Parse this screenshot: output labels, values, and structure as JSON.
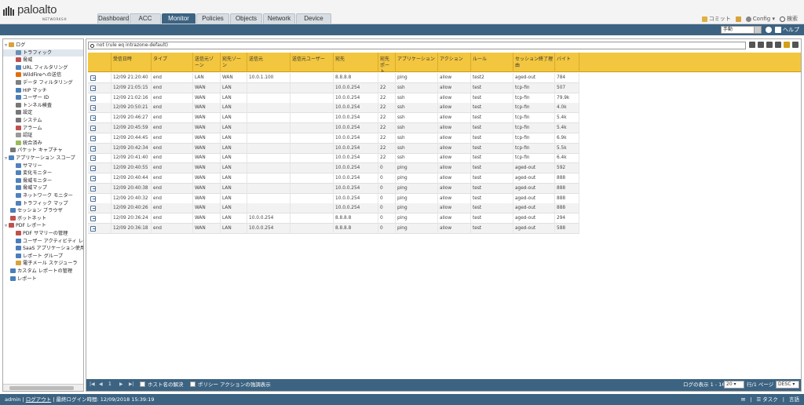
{
  "header": {
    "logo_text": "paloalto",
    "logo_sub": "NETWORKS®",
    "tabs": [
      {
        "label": "Dashboard",
        "active": false
      },
      {
        "label": "ACC",
        "active": false
      },
      {
        "label": "Monitor",
        "active": true
      },
      {
        "label": "Policies",
        "active": false
      },
      {
        "label": "Objects",
        "active": false
      },
      {
        "label": "Network",
        "active": false
      },
      {
        "label": "Device",
        "active": false
      }
    ],
    "commit": "コミット",
    "config": "Config",
    "search": "検索"
  },
  "toolbar": {
    "refresh_value": "手動",
    "help": "ヘルプ"
  },
  "sidebar": {
    "items": [
      {
        "label": "ログ",
        "indent": 0,
        "icon": "folder-icon",
        "color": "#d9a23a"
      },
      {
        "label": "トラフィック",
        "indent": 2,
        "icon": "traffic-log-icon",
        "color": "#6a8fb8",
        "selected": true
      },
      {
        "label": "脅威",
        "indent": 2,
        "icon": "threat-log-icon",
        "color": "#c0504d"
      },
      {
        "label": "URL フィルタリング",
        "indent": 2,
        "icon": "url-log-icon",
        "color": "#4f81bd"
      },
      {
        "label": "WildFireへの送信",
        "indent": 2,
        "icon": "wildfire-icon",
        "color": "#e46c0a"
      },
      {
        "label": "データ フィルタリング",
        "indent": 2,
        "icon": "data-filter-icon",
        "color": "#7f7f7f"
      },
      {
        "label": "HIP マッチ",
        "indent": 2,
        "icon": "hip-icon",
        "color": "#4a7ebb"
      },
      {
        "label": "ユーザー ID",
        "indent": 2,
        "icon": "user-id-icon",
        "color": "#4a7ebb"
      },
      {
        "label": "トンネル検査",
        "indent": 2,
        "icon": "tunnel-icon",
        "color": "#777777"
      },
      {
        "label": "設定",
        "indent": 2,
        "icon": "config-log-icon",
        "color": "#777777"
      },
      {
        "label": "システム",
        "indent": 2,
        "icon": "system-log-icon",
        "color": "#777777"
      },
      {
        "label": "アラーム",
        "indent": 2,
        "icon": "alarm-icon",
        "color": "#c0504d"
      },
      {
        "label": "認証",
        "indent": 2,
        "icon": "auth-icon",
        "color": "#999999"
      },
      {
        "label": "統合済み",
        "indent": 2,
        "icon": "unified-icon",
        "color": "#9bbb59"
      },
      {
        "label": "パケット キャプチャ",
        "indent": 1,
        "icon": "packet-capture-icon",
        "color": "#777777"
      },
      {
        "label": "アプリケーション スコープ",
        "indent": 0,
        "icon": "app-scope-icon",
        "color": "#4f81bd"
      },
      {
        "label": "サマリー",
        "indent": 2,
        "icon": "summary-icon",
        "color": "#4f81bd"
      },
      {
        "label": "変化モニター",
        "indent": 2,
        "icon": "change-monitor-icon",
        "color": "#4f81bd"
      },
      {
        "label": "脅威モニター",
        "indent": 2,
        "icon": "threat-monitor-icon",
        "color": "#4f81bd"
      },
      {
        "label": "脅威マップ",
        "indent": 2,
        "icon": "threat-map-icon",
        "color": "#4f81bd"
      },
      {
        "label": "ネットワーク モニター",
        "indent": 2,
        "icon": "network-monitor-icon",
        "color": "#4f81bd"
      },
      {
        "label": "トラフィック マップ",
        "indent": 2,
        "icon": "traffic-map-icon",
        "color": "#4f81bd"
      },
      {
        "label": "セッション ブラウザ",
        "indent": 1,
        "icon": "session-browser-icon",
        "color": "#4a7ebb"
      },
      {
        "label": "ボットネット",
        "indent": 1,
        "icon": "botnet-icon",
        "color": "#c0504d"
      },
      {
        "label": "PDF レポート",
        "indent": 0,
        "icon": "pdf-folder-icon",
        "color": "#c0504d"
      },
      {
        "label": "PDF サマリーの管理",
        "indent": 2,
        "icon": "pdf-icon",
        "color": "#c0504d"
      },
      {
        "label": "ユーザー アクティビティ レポート",
        "indent": 2,
        "icon": "user-activity-icon",
        "color": "#4a7ebb"
      },
      {
        "label": "SaaS アプリケーション使用率",
        "indent": 2,
        "icon": "saas-icon",
        "color": "#4a7ebb"
      },
      {
        "label": "レポート グループ",
        "indent": 2,
        "icon": "report-group-icon",
        "color": "#4a7ebb"
      },
      {
        "label": "電子メール スケジューラ",
        "indent": 2,
        "icon": "email-icon",
        "color": "#d9a23a"
      },
      {
        "label": "カスタム レポートの管理",
        "indent": 1,
        "icon": "custom-report-icon",
        "color": "#4a7ebb"
      },
      {
        "label": "レポート",
        "indent": 1,
        "icon": "report-icon",
        "color": "#4a7ebb"
      }
    ]
  },
  "filter": {
    "query": "not (rule eq intrazone-default)"
  },
  "table": {
    "columns": [
      "受信日時",
      "タイプ",
      "送信元ゾーン",
      "宛先ゾーン",
      "送信元",
      "送信元ユーザー",
      "宛先",
      "宛先ポート",
      "アプリケーション",
      "アクション",
      "ルール",
      "セッション終了理由",
      "バイト"
    ],
    "rows": [
      [
        "12/09 21:20:40",
        "end",
        "LAN",
        "WAN",
        "10.0.1.100",
        "",
        "8.8.8.8",
        "",
        "ping",
        "allow",
        "test2",
        "aged-out",
        "784"
      ],
      [
        "12/09 21:05:15",
        "end",
        "WAN",
        "LAN",
        "",
        "",
        "10.0.0.254",
        "22",
        "ssh",
        "allow",
        "test",
        "tcp-fin",
        "507"
      ],
      [
        "12/09 21:02:16",
        "end",
        "WAN",
        "LAN",
        "",
        "",
        "10.0.0.254",
        "22",
        "ssh",
        "allow",
        "test",
        "tcp-fin",
        "79.9k"
      ],
      [
        "12/09 20:50:21",
        "end",
        "WAN",
        "LAN",
        "",
        "",
        "10.0.0.254",
        "22",
        "ssh",
        "allow",
        "test",
        "tcp-fin",
        "4.0k"
      ],
      [
        "12/09 20:46:27",
        "end",
        "WAN",
        "LAN",
        "",
        "",
        "10.0.0.254",
        "22",
        "ssh",
        "allow",
        "test",
        "tcp-fin",
        "5.4k"
      ],
      [
        "12/09 20:45:59",
        "end",
        "WAN",
        "LAN",
        "",
        "",
        "10.0.0.254",
        "22",
        "ssh",
        "allow",
        "test",
        "tcp-fin",
        "5.4k"
      ],
      [
        "12/09 20:44:45",
        "end",
        "WAN",
        "LAN",
        "",
        "",
        "10.0.0.254",
        "22",
        "ssh",
        "allow",
        "test",
        "tcp-fin",
        "6.9k"
      ],
      [
        "12/09 20:42:34",
        "end",
        "WAN",
        "LAN",
        "",
        "",
        "10.0.0.254",
        "22",
        "ssh",
        "allow",
        "test",
        "tcp-fin",
        "5.5k"
      ],
      [
        "12/09 20:41:40",
        "end",
        "WAN",
        "LAN",
        "",
        "",
        "10.0.0.254",
        "22",
        "ssh",
        "allow",
        "test",
        "tcp-fin",
        "6.4k"
      ],
      [
        "12/09 20:40:55",
        "end",
        "WAN",
        "LAN",
        "",
        "",
        "10.0.0.254",
        "0",
        "ping",
        "allow",
        "test",
        "aged-out",
        "592"
      ],
      [
        "12/09 20:40:44",
        "end",
        "WAN",
        "LAN",
        "",
        "",
        "10.0.0.254",
        "0",
        "ping",
        "allow",
        "test",
        "aged-out",
        "888"
      ],
      [
        "12/09 20:40:38",
        "end",
        "WAN",
        "LAN",
        "",
        "",
        "10.0.0.254",
        "0",
        "ping",
        "allow",
        "test",
        "aged-out",
        "888"
      ],
      [
        "12/09 20:40:32",
        "end",
        "WAN",
        "LAN",
        "",
        "",
        "10.0.0.254",
        "0",
        "ping",
        "allow",
        "test",
        "aged-out",
        "888"
      ],
      [
        "12/09 20:40:26",
        "end",
        "WAN",
        "LAN",
        "",
        "",
        "10.0.0.254",
        "0",
        "ping",
        "allow",
        "test",
        "aged-out",
        "888"
      ],
      [
        "12/09 20:36:24",
        "end",
        "WAN",
        "LAN",
        "10.0.0.254",
        "",
        "8.8.8.8",
        "0",
        "ping",
        "allow",
        "test",
        "aged-out",
        "294"
      ],
      [
        "12/09 20:36:18",
        "end",
        "WAN",
        "LAN",
        "10.0.0.254",
        "",
        "8.8.8.8",
        "0",
        "ping",
        "allow",
        "test",
        "aged-out",
        "588"
      ]
    ]
  },
  "pager": {
    "page": "1",
    "resolve_hostname": "ホスト名の解決",
    "policy_highlight": "ポリシー アクションの強調表示",
    "display_label": "ログの表示 1 - 16",
    "per_page": "20",
    "per_page_suffix": "行/1 ページ",
    "sort": "DESC"
  },
  "statusbar": {
    "user": "admin",
    "logout": "ログアウト",
    "last_login": "最終ログイン時間: 12/09/2018 15:39:19",
    "tasks": "タスク",
    "language": "言語"
  }
}
